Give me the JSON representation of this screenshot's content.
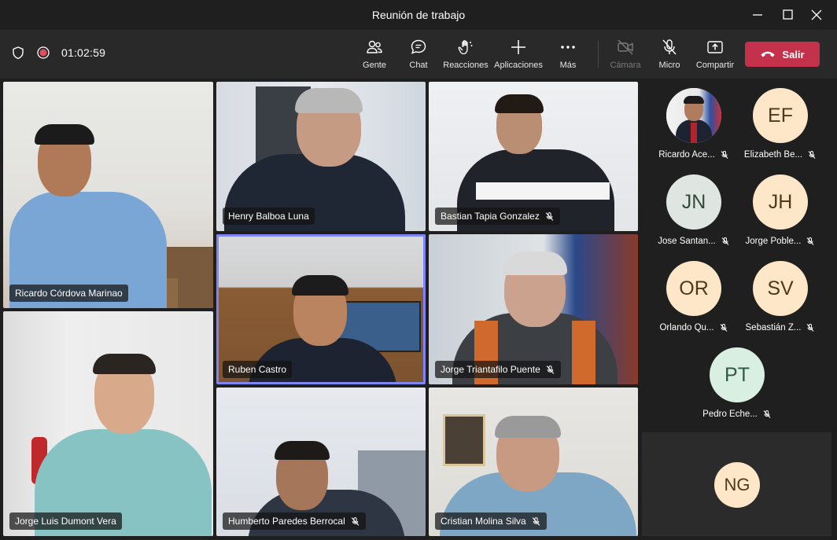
{
  "window": {
    "title": "Reunión de trabajo"
  },
  "toolbar": {
    "timer": "01:02:59",
    "buttons": [
      {
        "label": "Gente",
        "icon": "people-icon"
      },
      {
        "label": "Chat",
        "icon": "chat-icon"
      },
      {
        "label": "Reacciones",
        "icon": "reactions-icon"
      },
      {
        "label": "Aplicaciones",
        "icon": "add-apps-icon"
      },
      {
        "label": "Más",
        "icon": "more-icon"
      },
      {
        "label": "Cámara",
        "icon": "camera-off-icon"
      },
      {
        "label": "Micro",
        "icon": "mic-off-icon"
      },
      {
        "label": "Compartir",
        "icon": "share-icon"
      }
    ],
    "leave_label": "Salir"
  },
  "participants_video": [
    {
      "name": "Ricardo Córdova Marinao",
      "muted": false
    },
    {
      "name": "Henry Balboa Luna",
      "muted": false
    },
    {
      "name": "Bastian Tapia Gonzalez",
      "muted": true
    },
    {
      "name": "Ruben Castro",
      "muted": false,
      "speaking": true
    },
    {
      "name": "Jorge Triantafilo Puente",
      "muted": true
    },
    {
      "name": "Jorge Luis Dumont Vera",
      "muted": false
    },
    {
      "name": "Humberto Paredes Berrocal",
      "muted": true
    },
    {
      "name": "Cristian Molina Silva",
      "muted": true
    }
  ],
  "roster": [
    {
      "initials": "",
      "name": "Ricardo Ace...",
      "muted": true,
      "photo": true
    },
    {
      "initials": "EF",
      "name": "Elizabeth Be...",
      "muted": true
    },
    {
      "initials": "JN",
      "name": "Jose Santan...",
      "muted": true
    },
    {
      "initials": "JH",
      "name": "Jorge Poble...",
      "muted": true
    },
    {
      "initials": "OR",
      "name": "Orlando Qu...",
      "muted": true
    },
    {
      "initials": "SV",
      "name": "Sebastián Z...",
      "muted": true
    },
    {
      "initials": "PT",
      "name": "Pedro Eche...",
      "muted": true
    }
  ],
  "overflow_tile": {
    "initials": "NG"
  },
  "colors": {
    "accent": "#7f85f5",
    "leave": "#c4314b",
    "avatar_peach": "#fde7c8",
    "avatar_mint": "#d9efe2",
    "avatar_gray": "#dfe6e1"
  }
}
